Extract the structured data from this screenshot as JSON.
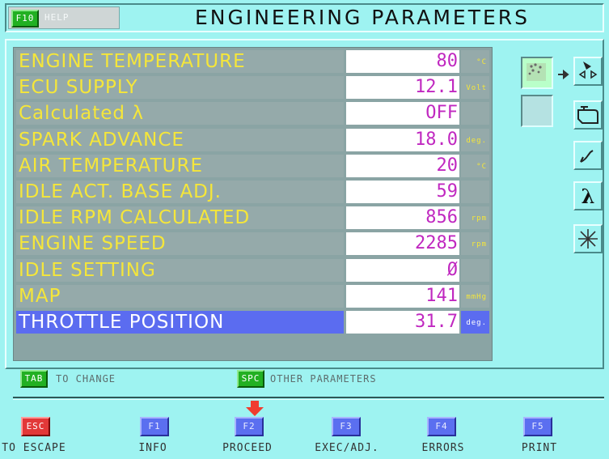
{
  "header": {
    "help_key": "F10",
    "help_label": "HELP",
    "title": "ENGINEERING PARAMETERS"
  },
  "parameters": [
    {
      "name": "ENGINE TEMPERATURE",
      "value": "80",
      "unit": "°C"
    },
    {
      "name": "ECU SUPPLY",
      "value": "12.1",
      "unit": "Volt"
    },
    {
      "name": "Calculated λ",
      "value": "OFF",
      "unit": ""
    },
    {
      "name": "SPARK ADVANCE",
      "value": "18.0",
      "unit": "deg."
    },
    {
      "name": "AIR TEMPERATURE",
      "value": "20",
      "unit": "°C"
    },
    {
      "name": "IDLE ACT. BASE ADJ.",
      "value": "59",
      "unit": ""
    },
    {
      "name": "IDLE RPM CALCULATED",
      "value": "856",
      "unit": "rpm"
    },
    {
      "name": "ENGINE SPEED",
      "value": "2285",
      "unit": "rpm"
    },
    {
      "name": "IDLE SETTING",
      "value": "Ø",
      "unit": ""
    },
    {
      "name": "MAP",
      "value": "141",
      "unit": "mmHg"
    },
    {
      "name": "THROTTLE POSITION",
      "value": "31.7",
      "unit": "deg."
    }
  ],
  "selected_index": 10,
  "hints": {
    "tab_key": "TAB",
    "tab_text": "TO CHANGE",
    "spc_key": "SPC",
    "spc_text": "OTHER PARAMETERS"
  },
  "function_keys": [
    {
      "key": "ESC",
      "label": "TO ESCAPE"
    },
    {
      "key": "F1",
      "label": "INFO"
    },
    {
      "key": "F2",
      "label": "PROCEED"
    },
    {
      "key": "F3",
      "label": "EXEC/ADJ."
    },
    {
      "key": "F4",
      "label": "ERRORS"
    },
    {
      "key": "F5",
      "label": "PRINT"
    }
  ],
  "side_icons": [
    "engine-diagram-icon",
    "engine-block-icon",
    "lambda-sensor-icon",
    "lambda-icon",
    "snowflake-icon"
  ],
  "colors": {
    "background": "#9ef3f1",
    "label_text": "#f5e63a",
    "value_text": "#c028c0",
    "selected_row": "#5b6cf0"
  }
}
